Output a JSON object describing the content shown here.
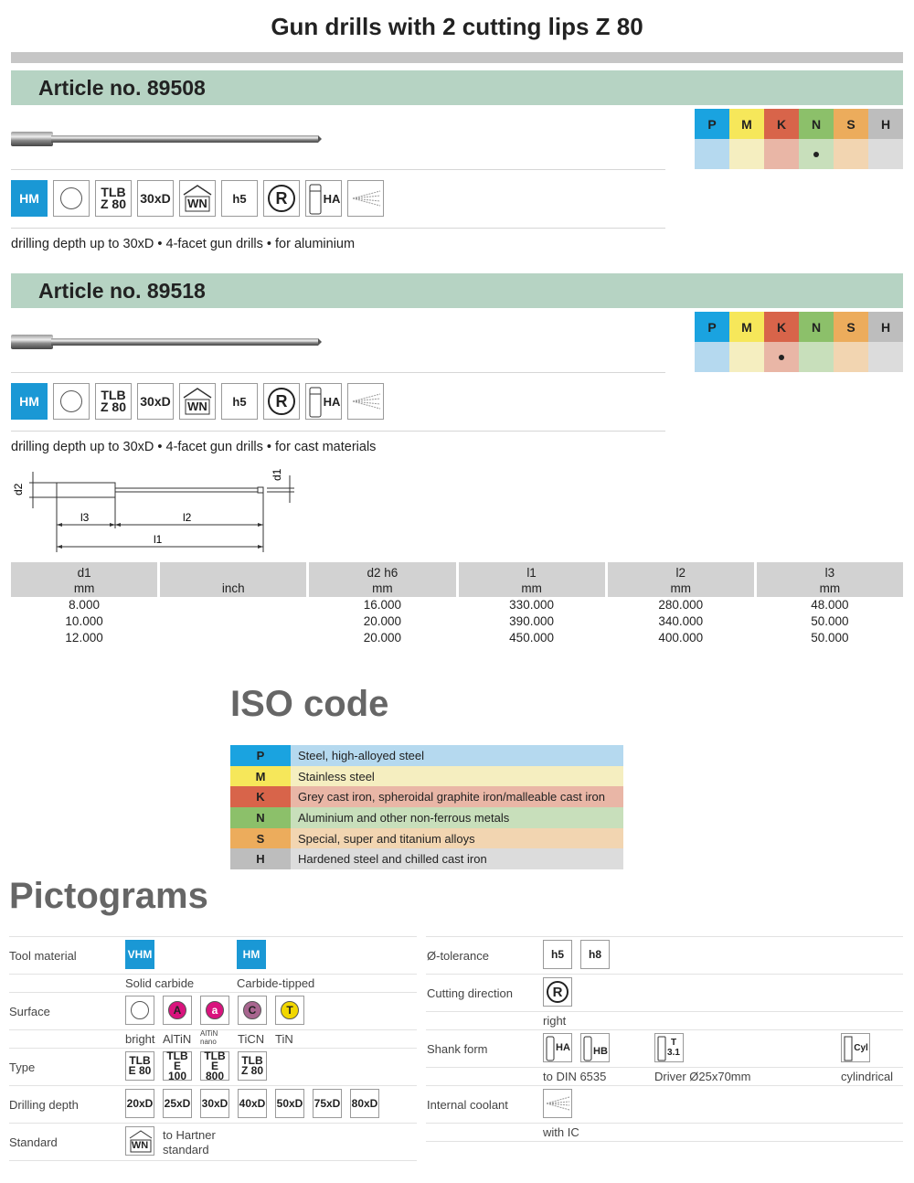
{
  "title": "Gun drills with 2 cutting lips Z 80",
  "iso_headers": [
    "P",
    "M",
    "K",
    "N",
    "S",
    "H"
  ],
  "iso_colors": {
    "P": {
      "head": "#1aa3e0",
      "cell": "#b5d9ef"
    },
    "M": {
      "head": "#f6e75a",
      "cell": "#f5eec0"
    },
    "K": {
      "head": "#d8644a",
      "cell": "#e9b6a6"
    },
    "N": {
      "head": "#8cc06a",
      "cell": "#c8dfbb"
    },
    "S": {
      "head": "#ecac5c",
      "cell": "#f2d5b1"
    },
    "H": {
      "head": "#bdbdbd",
      "cell": "#dcdcdc"
    }
  },
  "articles": [
    {
      "label": "Article no.",
      "number": "89508",
      "iso_marks": [
        "",
        "",
        "",
        "•",
        "",
        ""
      ],
      "description": "drilling depth up to 30xD • 4-facet gun drills • for aluminium"
    },
    {
      "label": "Article no.",
      "number": "89518",
      "iso_marks": [
        "",
        "",
        "•",
        "",
        "",
        ""
      ],
      "description": "drilling depth up to 30xD • 4-facet gun drills • for cast materials"
    }
  ],
  "pictograms_row": {
    "hm": "HM",
    "tlb1": "TLB",
    "tlb2": "Z 80",
    "depth": "30xD",
    "wn": "WN",
    "tol": "h5",
    "dir": "R",
    "shank": "HA"
  },
  "dimension_labels": {
    "d2": "d2",
    "d1": "d1",
    "l3": "l3",
    "l2": "l2",
    "l1": "l1"
  },
  "dim_table": {
    "headers": [
      [
        "d1",
        "mm"
      ],
      [
        "",
        "inch"
      ],
      [
        "d2 h6",
        "mm"
      ],
      [
        "l1",
        "mm"
      ],
      [
        "l2",
        "mm"
      ],
      [
        "l3",
        "mm"
      ]
    ],
    "rows": [
      [
        "8.000",
        "",
        "16.000",
        "330.000",
        "280.000",
        "48.000"
      ],
      [
        "10.000",
        "",
        "20.000",
        "390.000",
        "340.000",
        "50.000"
      ],
      [
        "12.000",
        "",
        "20.000",
        "450.000",
        "400.000",
        "50.000"
      ]
    ]
  },
  "iso_code": {
    "title": "ISO code",
    "rows": [
      {
        "key": "P",
        "text": "Steel, high-alloyed steel"
      },
      {
        "key": "M",
        "text": "Stainless steel"
      },
      {
        "key": "K",
        "text": "Grey cast iron, spheroidal graphite iron/malleable cast iron"
      },
      {
        "key": "N",
        "text": "Aluminium and other non-ferrous metals"
      },
      {
        "key": "S",
        "text": "Special, super and titanium alloys"
      },
      {
        "key": "H",
        "text": "Hardened steel and chilled cast iron"
      }
    ]
  },
  "legend": {
    "title": "Pictograms",
    "tool_material": {
      "label": "Tool material",
      "vhm": "VHM",
      "vhm_sub": "Solid carbide",
      "hm": "HM",
      "hm_sub": "Carbide-tipped"
    },
    "surface": {
      "label": "Surface",
      "items": [
        "bright",
        "AlTiN",
        "AlTiN nano",
        "TiCN",
        "TiN"
      ],
      "letters": [
        "",
        "A",
        "a",
        "C",
        "T"
      ]
    },
    "type": {
      "label": "Type",
      "items": [
        [
          "TLB",
          "E 80"
        ],
        [
          "TLB",
          "E 100"
        ],
        [
          "TLB",
          "E 800"
        ],
        [
          "TLB",
          "Z 80"
        ]
      ]
    },
    "drilling_depth": {
      "label": "Drilling depth",
      "items": [
        "20xD",
        "25xD",
        "30xD",
        "40xD",
        "50xD",
        "75xD",
        "80xD"
      ]
    },
    "standard": {
      "label": "Standard",
      "icon": "WN",
      "text1": "to Hartner",
      "text2": "standard"
    },
    "tolerance": {
      "label": "Ø-tolerance",
      "items": [
        "h5",
        "h8"
      ]
    },
    "cutting_direction": {
      "label": "Cutting direction",
      "icon": "R",
      "sub": "right"
    },
    "shank_form": {
      "label": "Shank form",
      "ha": "HA",
      "hb": "HB",
      "t": "T",
      "t2": "3.1",
      "cyl": "Cyl",
      "sub1": "to DIN 6535",
      "sub2": "Driver Ø25x70mm",
      "sub3": "cylindrical"
    },
    "internal_coolant": {
      "label": "Internal coolant",
      "sub": "with IC"
    }
  }
}
